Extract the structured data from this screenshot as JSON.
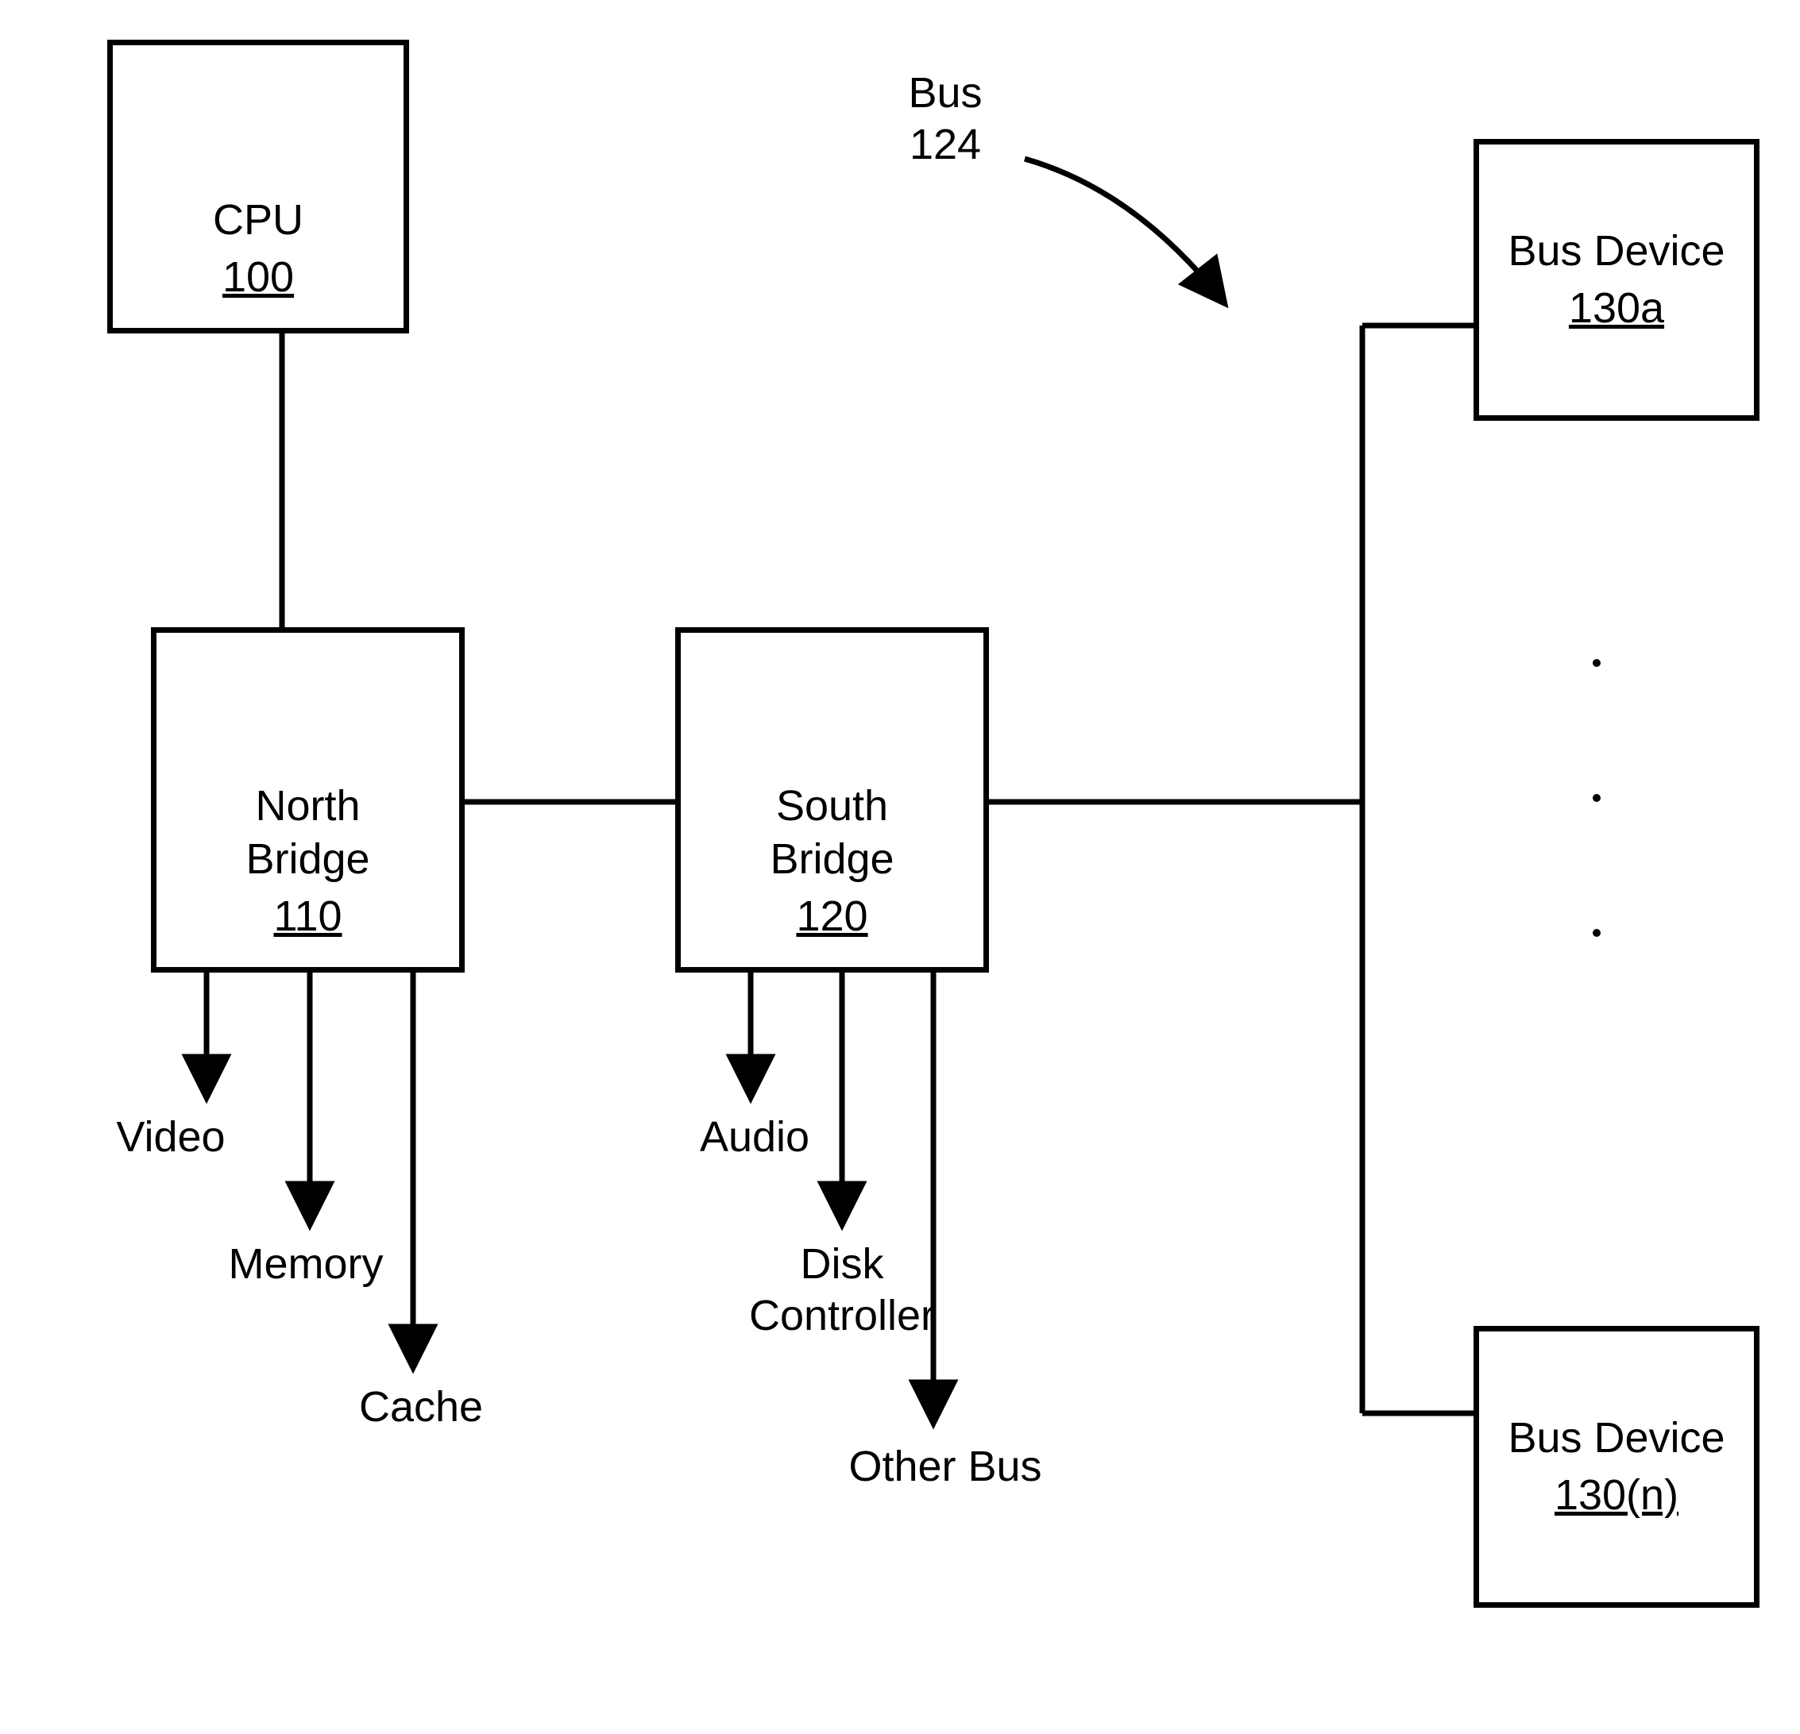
{
  "blocks": {
    "cpu": {
      "title": "CPU",
      "ref": "100"
    },
    "northBridge": {
      "title": "North\nBridge",
      "ref": "110"
    },
    "southBridge": {
      "title": "South\nBridge",
      "ref": "120"
    },
    "busDeviceA": {
      "title": "Bus Device",
      "ref": "130a"
    },
    "busDeviceN": {
      "title": "Bus Device",
      "ref": "130(n)"
    }
  },
  "busLabel": "Bus\n124",
  "nbOutputs": {
    "video": "Video",
    "memory": "Memory",
    "cache": "Cache"
  },
  "sbOutputs": {
    "audio": "Audio",
    "diskController": "Disk\nController",
    "otherBus": "Other Bus"
  }
}
